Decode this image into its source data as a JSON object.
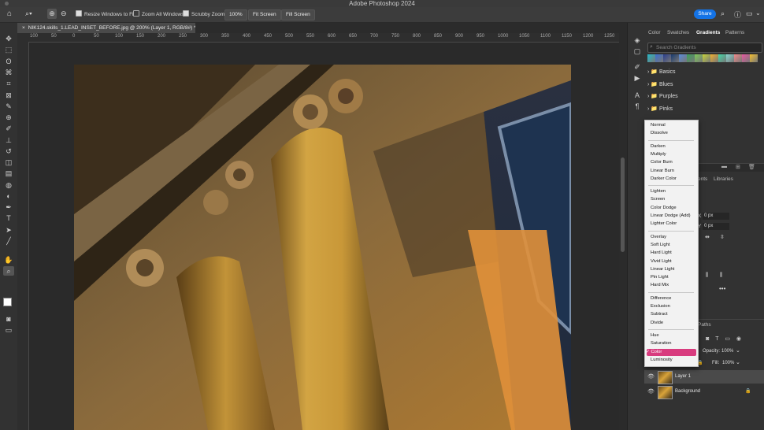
{
  "app": {
    "title": "Adobe Photoshop 2024"
  },
  "options_bar": {
    "resize_windows": "Resize Windows to Fit",
    "zoom_all": "Zoom All Windows",
    "scrubby_zoom": "Scrubby Zoom",
    "zoom_value": "100%",
    "fit_screen": "Fit Screen",
    "fill_screen": "Fill Screen",
    "share": "Share"
  },
  "document": {
    "tab_title": "NIK124.skills_1.LEAD_INSET_BEFORE.jpg @ 200% (Layer 1, RGB/8#) *"
  },
  "ruler": {
    "ticks": [
      "100",
      "50",
      "0",
      "50",
      "100",
      "150",
      "200",
      "250",
      "300",
      "350",
      "400",
      "450",
      "500",
      "550",
      "600",
      "650",
      "700",
      "750",
      "800",
      "850",
      "900",
      "950",
      "1000",
      "1050",
      "1100",
      "1150",
      "1200",
      "1250"
    ]
  },
  "panel": {
    "tabs": [
      "Color",
      "Swatches",
      "Gradients",
      "Patterns"
    ],
    "active_tab": "Gradients",
    "search_placeholder": "Search Gradients",
    "folders": [
      "Basics",
      "Blues",
      "Purples",
      "Pinks"
    ],
    "swatch_colors": [
      "#26b8c9",
      "#3a6fd1",
      "#2a3e8c",
      "#183a6e",
      "#5a8bd8",
      "#3c9f5a",
      "#7fc95a",
      "#c8d43a",
      "#f0b030",
      "#45d8a8",
      "#8ad6d0",
      "#f08a8a",
      "#e85aa0",
      "#f5c030"
    ]
  },
  "properties": {
    "tab_partial": "ents",
    "libraries_tab": "Libraries",
    "x_label": "X",
    "x_value": "0 px",
    "y_label": "Y",
    "y_value": "0 px"
  },
  "blend_modes": {
    "groups": [
      [
        "Normal",
        "Dissolve"
      ],
      [
        "Darken",
        "Multiply",
        "Color Burn",
        "Linear Burn",
        "Darker Color"
      ],
      [
        "Lighten",
        "Screen",
        "Color Dodge",
        "Linear Dodge (Add)",
        "Lighter Color"
      ],
      [
        "Overlay",
        "Soft Light",
        "Hard Light",
        "Vivid Light",
        "Linear Light",
        "Pin Light",
        "Hard Mix"
      ],
      [
        "Difference",
        "Exclusion",
        "Subtract",
        "Divide"
      ],
      [
        "Hue",
        "Saturation",
        "Color",
        "Luminosity"
      ]
    ],
    "selected": "Color",
    "selected_color": "#d83b7e"
  },
  "layers": {
    "paths_tab": "Paths",
    "opacity_label": "Opacity:",
    "opacity_value": "100%",
    "fill_label": "Fill:",
    "fill_value": "100%",
    "items": [
      "Layer 1",
      "Background"
    ]
  }
}
